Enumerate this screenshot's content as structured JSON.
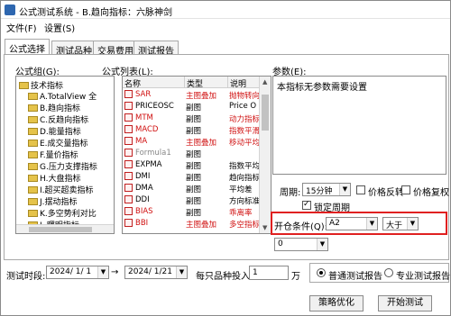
{
  "window": {
    "title": "公式测试系统 - B.趋向指标：六脉神剑"
  },
  "menu": {
    "file": "文件(F)",
    "settings": "设置(S)"
  },
  "tabs": [
    "公式选择",
    "测试品种",
    "交易费用",
    "测试报告"
  ],
  "formula_group": {
    "label": "公式组(G):",
    "root": "技术指标",
    "items": [
      "A.TotalView 全",
      "B.趋向指标",
      "C.反趋向指标",
      "D.能量指标",
      "E.成交量指标",
      "F.量价指标",
      "G.压力支撑指标",
      "H.大盘指标",
      "I.超买超卖指标",
      "J.摆动指标",
      "K.多空势利对比",
      "L.曙明指标"
    ]
  },
  "formula_list": {
    "label": "公式列表(L):",
    "columns": [
      "名称",
      "类型",
      "说明"
    ],
    "rows": [
      {
        "name": "SAR",
        "type": "主图叠加",
        "desc": "抛物转向",
        "color": "#d01010"
      },
      {
        "name": "PRICEOSC",
        "type": "副图",
        "desc": "Price O",
        "color": "#000000"
      },
      {
        "name": "MTM",
        "type": "副图",
        "desc": "动力指标",
        "color": "#d01010"
      },
      {
        "name": "MACD",
        "type": "副图",
        "desc": "指数平滑",
        "color": "#d01010"
      },
      {
        "name": "MA",
        "type": "主图叠加",
        "desc": "移动平均",
        "color": "#d01010"
      },
      {
        "name": "Formula1",
        "type": "副图",
        "desc": "",
        "color": "#888888"
      },
      {
        "name": "EXPMA",
        "type": "副图",
        "desc": "指数平均",
        "color": "#000000"
      },
      {
        "name": "DMI",
        "type": "副图",
        "desc": "趋向指标",
        "color": "#000000"
      },
      {
        "name": "DMA",
        "type": "副图",
        "desc": "平均差",
        "color": "#000000"
      },
      {
        "name": "DDI",
        "type": "副图",
        "desc": "方向标准",
        "color": "#000000"
      },
      {
        "name": "BIAS",
        "type": "副图",
        "desc": "乖离率",
        "color": "#d01010"
      },
      {
        "name": "BBI",
        "type": "主图叠加",
        "desc": "多空指标",
        "color": "#d01010"
      }
    ]
  },
  "params": {
    "label": "参数(E):",
    "text": "本指标无参数需要设置"
  },
  "period": {
    "label": "周期:",
    "value": "15分钟",
    "price_reverse": "价格反转",
    "price_restore": "价格复权",
    "lock_period": "锁定周期"
  },
  "open_condition": {
    "label": "开仓条件(Q):",
    "value": "A2",
    "operator": "大于",
    "threshold": "0"
  },
  "test_time": {
    "label": "测试时段:",
    "start": "2024/ 1/ 1",
    "end": "2024/ 1/21"
  },
  "investment": {
    "label": "每只品种投入:",
    "value": "1",
    "unit": "万"
  },
  "report_mode": {
    "normal": "普通测试报告",
    "pro": "专业测试报告"
  },
  "buttons": {
    "strategy": "策略优化",
    "start": "开始测试"
  },
  "colors": {
    "highlight": "#e02020",
    "red_text": "#d01010",
    "background": "#1f4a7a"
  }
}
